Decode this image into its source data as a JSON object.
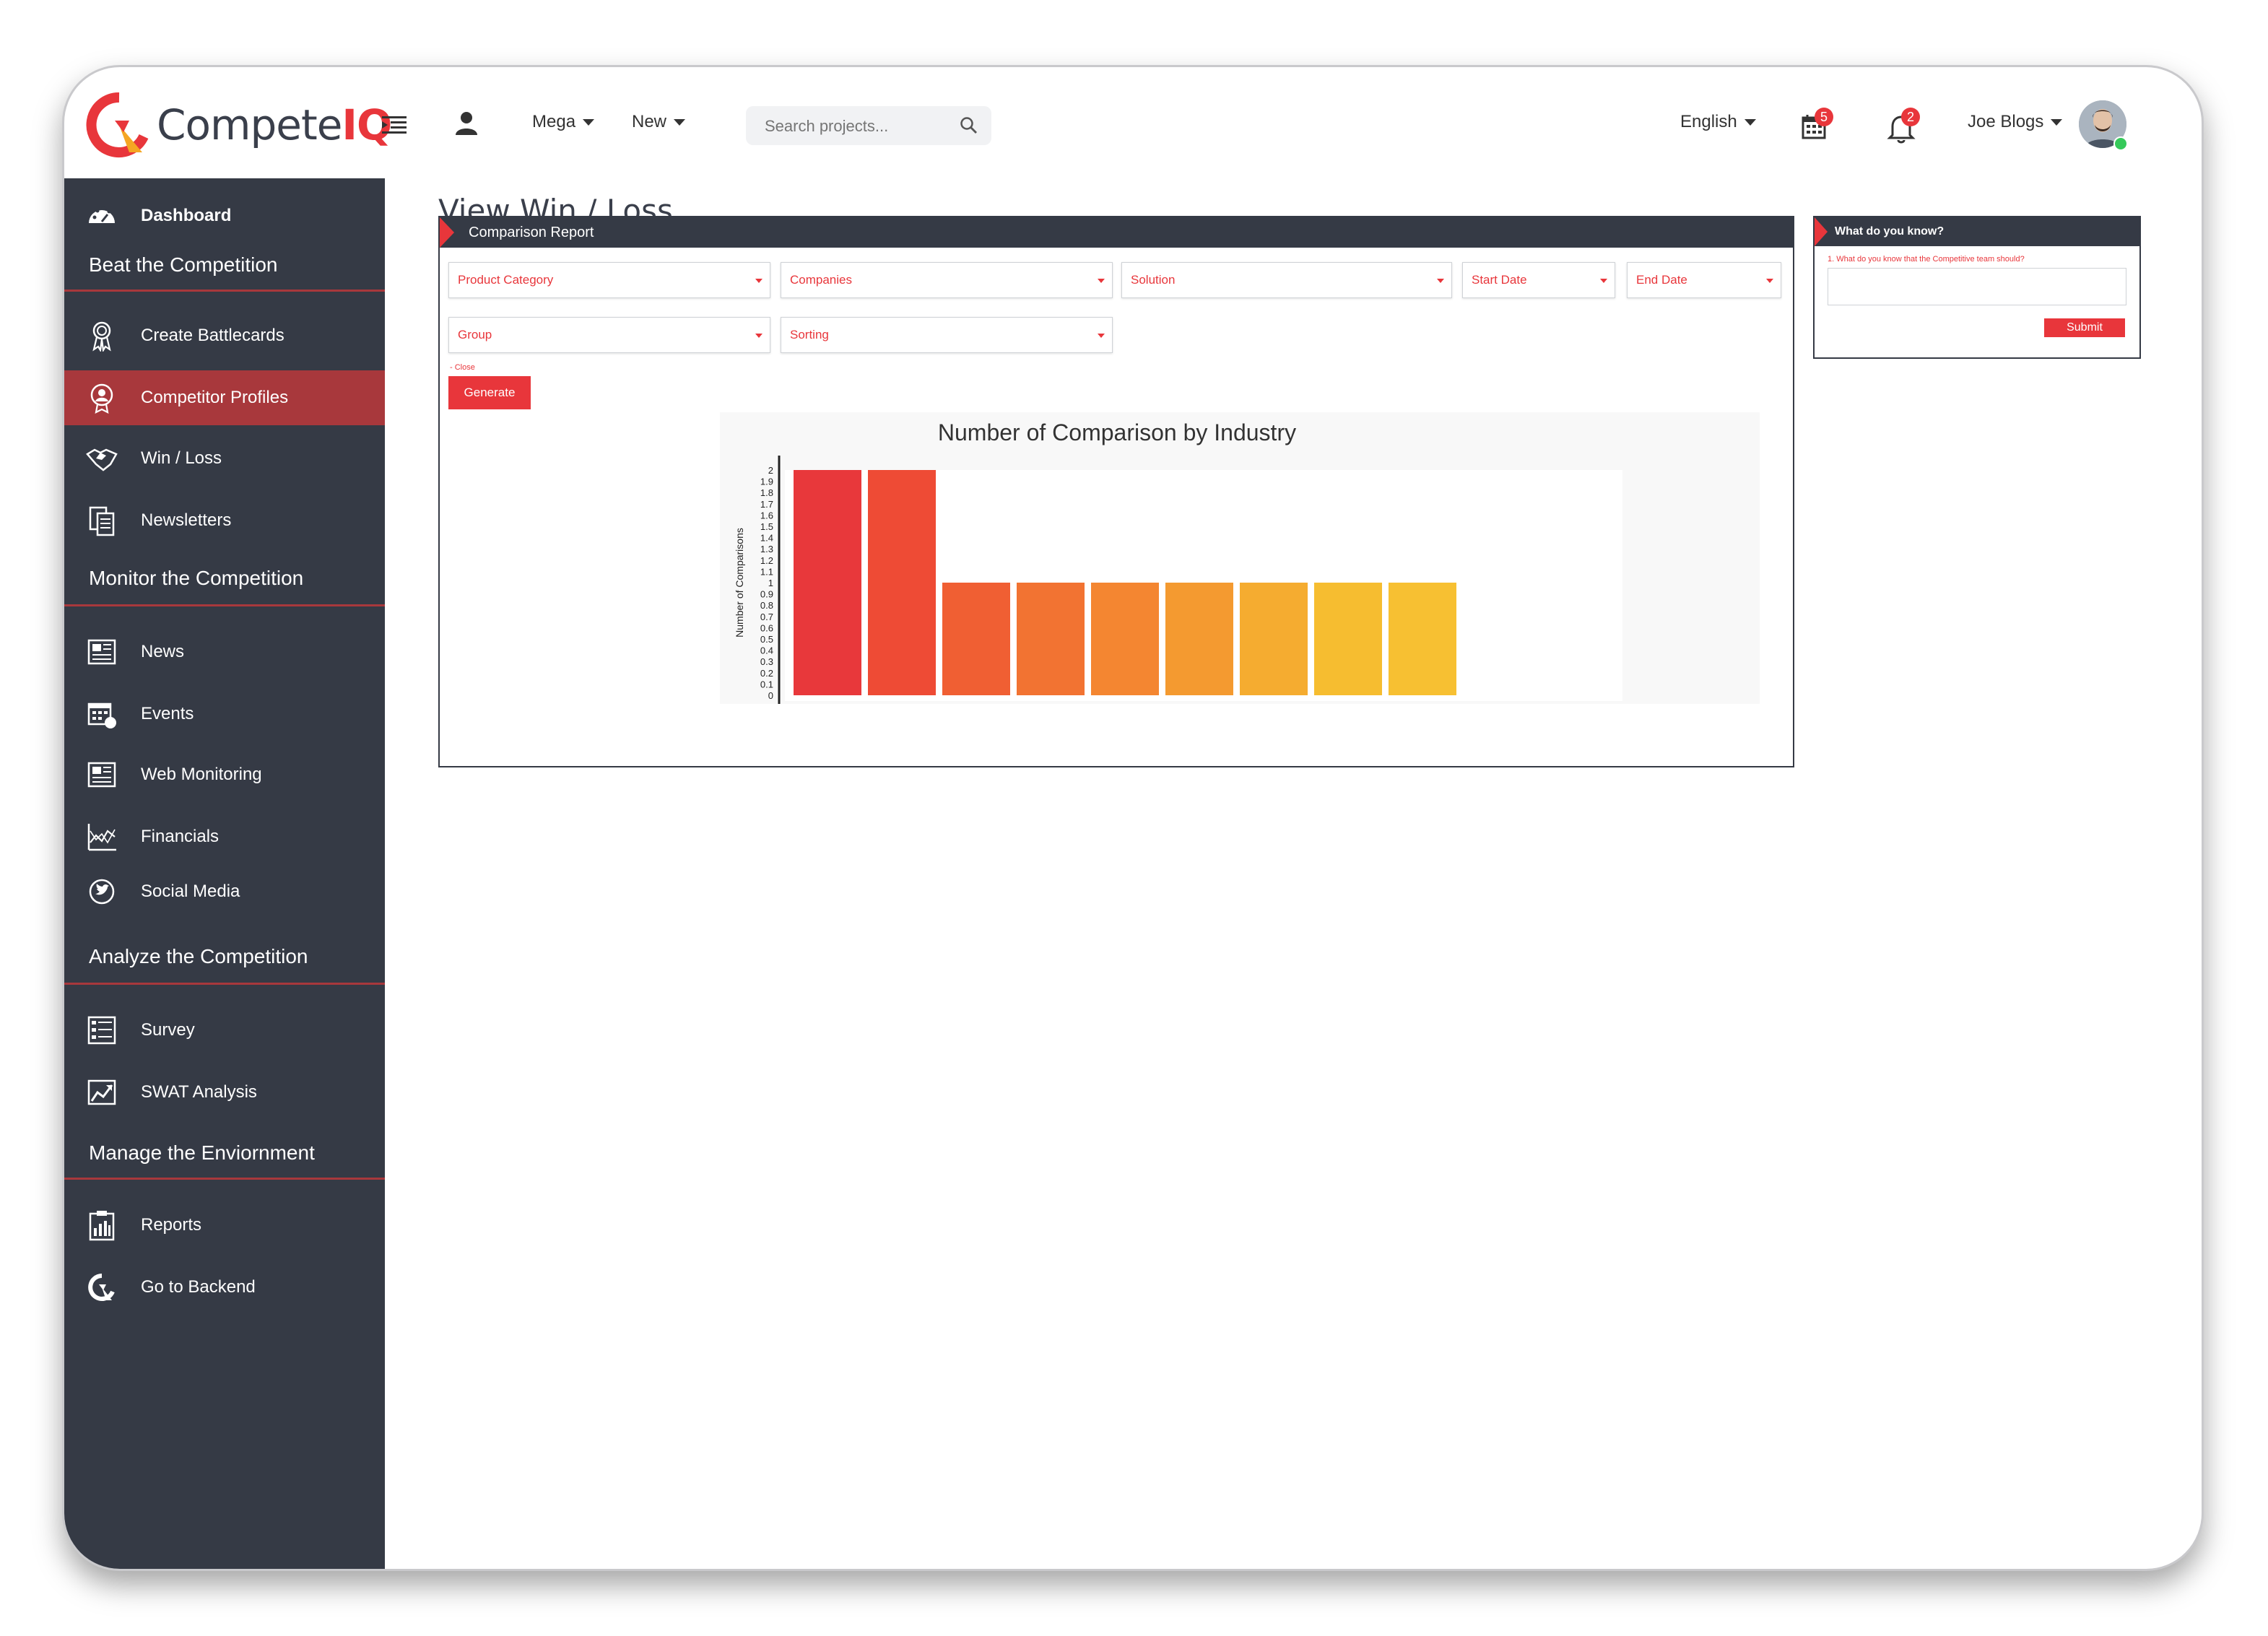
{
  "brand": {
    "name_main": "Compete",
    "name_accent": "IQ",
    "accent_color": "#e8363b",
    "sidebar_color": "#353a45",
    "active_color": "#a8383c"
  },
  "header": {
    "mega_label": "Mega",
    "new_label": "New",
    "search_placeholder": "Search projects...",
    "language": "English",
    "calendar_badge": "5",
    "notifications_badge": "2",
    "user_name": "Joe Blogs"
  },
  "sidebar": {
    "dashboard": "Dashboard",
    "sections": [
      {
        "title": "Beat the Competition"
      },
      {
        "title": "Monitor the Competition"
      },
      {
        "title": "Analyze the Competition"
      },
      {
        "title": "Manage the Enviornment"
      }
    ],
    "items": {
      "create_battlecards": "Create Battlecards",
      "competitor_profiles": "Competitor Profiles",
      "win_loss": "Win / Loss",
      "newsletters": "Newsletters",
      "news": "News",
      "events": "Events",
      "web_monitoring": "Web Monitoring",
      "financials": "Financials",
      "social_media": "Social Media",
      "survey": "Survey",
      "swat_analysis": "SWAT Analysis",
      "reports": "Reports",
      "go_to_backend": "Go to Backend"
    }
  },
  "page": {
    "title": "View Win / Loss",
    "panel_title": "Comparison Report",
    "filters": {
      "product_category": "Product Category",
      "companies": "Companies",
      "solution": "Solution",
      "start_date": "Start Date",
      "end_date": "End Date",
      "group": "Group",
      "sorting": "Sorting"
    },
    "close_label": "- Close",
    "generate_label": "Generate"
  },
  "aside": {
    "title": "What do you know?",
    "question": "1. What do you know that the Competitive team should?",
    "submit_label": "Submit"
  },
  "chart_data": {
    "type": "bar",
    "title": "Number of Comparison by Industry",
    "xlabel": "",
    "ylabel": "Number of Comparisons",
    "ylim": [
      0,
      2
    ],
    "y_ticks": [
      "2",
      "1.9",
      "1.8",
      "1.7",
      "1.6",
      "1.5",
      "1.4",
      "1.3",
      "1.2",
      "1.1",
      "1",
      "0.9",
      "0.8",
      "0.7",
      "0.6",
      "0.5",
      "0.4",
      "0.3",
      "0.2",
      "0.1",
      "0"
    ],
    "values": [
      2,
      2,
      1,
      1,
      1,
      1,
      1,
      1,
      1
    ],
    "colors": [
      "#e8383b",
      "#ee4b35",
      "#f05f33",
      "#f27332",
      "#f48631",
      "#f49a30",
      "#f5ac30",
      "#f6bd30",
      "#f7c032"
    ],
    "grid": false,
    "legend": "none"
  }
}
